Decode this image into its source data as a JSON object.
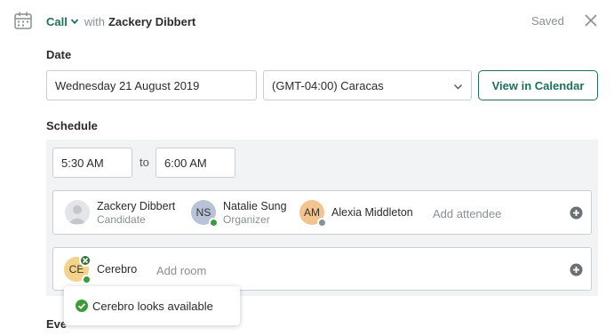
{
  "header": {
    "event_type": "Call",
    "with_text": "with",
    "candidate": "Zackery Dibbert",
    "status": "Saved"
  },
  "date_section": {
    "label": "Date",
    "date_value": "Wednesday 21 August 2019",
    "timezone": "(GMT-04:00) Caracas",
    "calendar_button": "View in Calendar"
  },
  "schedule": {
    "label": "Schedule",
    "start_time": "5:30 AM",
    "to_text": "to",
    "end_time": "6:00 AM",
    "attendees": [
      {
        "name": "Zackery Dibbert",
        "role": "Candidate",
        "initials": ""
      },
      {
        "name": "Natalie Sung",
        "role": "Organizer",
        "initials": "NS"
      },
      {
        "name": "Alexia Middleton",
        "role": "",
        "initials": "AM"
      }
    ],
    "add_attendee": "Add attendee",
    "room": {
      "initials": "CE",
      "name": "Cerebro"
    },
    "add_room": "Add room"
  },
  "tooltip": {
    "text": "Cerebro looks available"
  },
  "next_section": {
    "label": "Eve"
  },
  "colors": {
    "accent": "#1f6f5c",
    "available": "#3f9a3a",
    "panel": "#f2f3f4"
  }
}
